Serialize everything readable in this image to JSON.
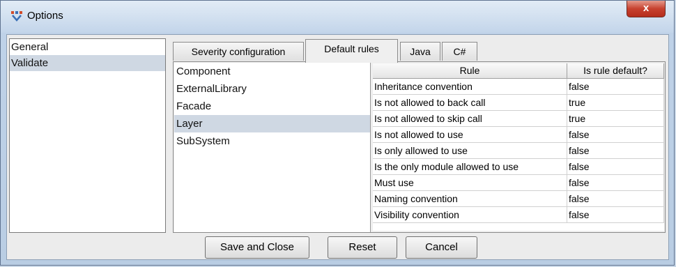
{
  "window": {
    "title": "Options",
    "close_label": "x"
  },
  "sidebar": {
    "items": [
      {
        "label": "General"
      },
      {
        "label": "Validate"
      }
    ]
  },
  "tabs": [
    {
      "label": "Severity configuration"
    },
    {
      "label": "Default rules"
    },
    {
      "label": "Java"
    },
    {
      "label": "C#"
    }
  ],
  "module_types": [
    {
      "label": "Component"
    },
    {
      "label": "ExternalLibrary"
    },
    {
      "label": "Facade"
    },
    {
      "label": "Layer"
    },
    {
      "label": "SubSystem"
    }
  ],
  "table": {
    "headers": {
      "rule": "Rule",
      "default": "Is rule default?"
    },
    "rows": [
      {
        "rule": "Inheritance convention",
        "default": "false"
      },
      {
        "rule": "Is not allowed to back call",
        "default": "true"
      },
      {
        "rule": "Is not allowed to skip call",
        "default": "true"
      },
      {
        "rule": "Is not allowed to use",
        "default": "false"
      },
      {
        "rule": "Is only allowed to use",
        "default": "false"
      },
      {
        "rule": "Is the only module allowed to use",
        "default": "false"
      },
      {
        "rule": "Must use",
        "default": "false"
      },
      {
        "rule": "Naming convention",
        "default": "false"
      },
      {
        "rule": "Visibility convention",
        "default": "false"
      }
    ]
  },
  "buttons": {
    "save": "Save and Close",
    "reset": "Reset",
    "cancel": "Cancel"
  }
}
